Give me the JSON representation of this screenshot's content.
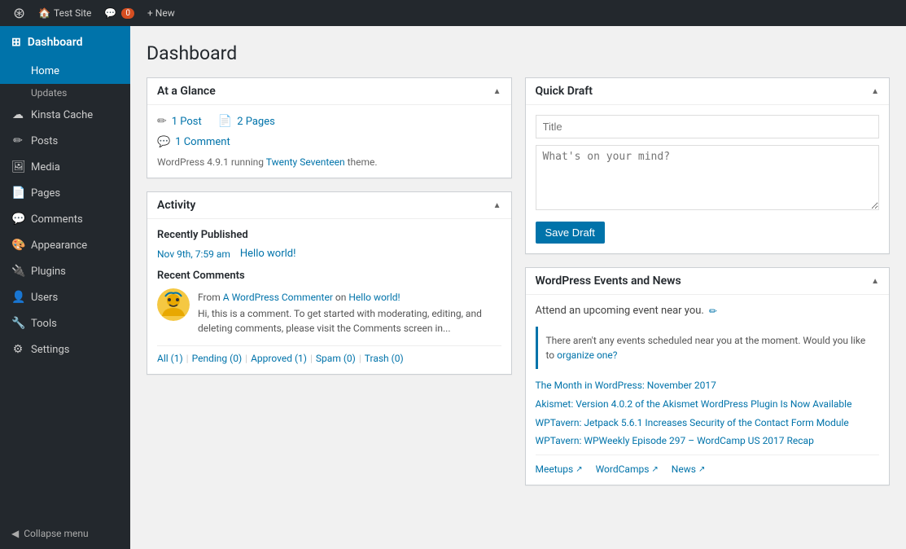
{
  "adminbar": {
    "site_name": "Test Site",
    "comments_count": "0",
    "new_label": "+ New"
  },
  "sidebar": {
    "logo_label": "Dashboard",
    "items": [
      {
        "id": "dashboard",
        "label": "Dashboard",
        "icon": "⊞",
        "active": true
      },
      {
        "id": "home",
        "label": "Home",
        "sub": true
      },
      {
        "id": "updates",
        "label": "Updates",
        "sub": true
      },
      {
        "id": "kinsta-cache",
        "label": "Kinsta Cache",
        "icon": "☁"
      },
      {
        "id": "posts",
        "label": "Posts",
        "icon": "📝"
      },
      {
        "id": "media",
        "label": "Media",
        "icon": "🖼"
      },
      {
        "id": "pages",
        "label": "Pages",
        "icon": "📄"
      },
      {
        "id": "comments",
        "label": "Comments",
        "icon": "💬"
      },
      {
        "id": "appearance",
        "label": "Appearance",
        "icon": "🎨"
      },
      {
        "id": "plugins",
        "label": "Plugins",
        "icon": "🔌"
      },
      {
        "id": "users",
        "label": "Users",
        "icon": "👤"
      },
      {
        "id": "tools",
        "label": "Tools",
        "icon": "🔧"
      },
      {
        "id": "settings",
        "label": "Settings",
        "icon": "⚙"
      }
    ],
    "collapse_label": "Collapse menu"
  },
  "page": {
    "title": "Dashboard"
  },
  "at_a_glance": {
    "widget_title": "At a Glance",
    "post_count": "1 Post",
    "page_count": "2 Pages",
    "comment_count": "1 Comment",
    "wp_info": "WordPress 4.9.1 running ",
    "theme_name": "Twenty Seventeen",
    "theme_suffix": " theme."
  },
  "activity": {
    "widget_title": "Activity",
    "recently_published_title": "Recently Published",
    "published_date": "Nov 9th, 7:59 am",
    "published_post": "Hello world!",
    "recent_comments_title": "Recent Comments",
    "comment_from": "From ",
    "comment_author": "A WordPress Commenter",
    "comment_on": " on ",
    "comment_post": "Hello world!",
    "comment_text": "Hi, this is a comment. To get started with moderating, editing, and deleting comments, please visit the Comments screen in...",
    "filter_all": "All (1)",
    "filter_pending": "Pending (0)",
    "filter_approved": "Approved (1)",
    "filter_spam": "Spam (0)",
    "filter_trash": "Trash (0)"
  },
  "quick_draft": {
    "widget_title": "Quick Draft",
    "title_placeholder": "Title",
    "body_placeholder": "What's on your mind?",
    "save_label": "Save Draft"
  },
  "events_news": {
    "widget_title": "WordPress Events and News",
    "attend_text": "Attend an upcoming event near you.",
    "no_events_text": "There aren't any events scheduled near you at the moment. Would you like to ",
    "organize_link": "organize one?",
    "news_items": [
      "The Month in WordPress: November 2017",
      "Akismet: Version 4.0.2 of the Akismet WordPress Plugin Is Now Available",
      "WPTavern: Jetpack 5.6.1 Increases Security of the Contact Form Module",
      "WPTavern: WPWeekly Episode 297 – WordCamp US 2017 Recap"
    ],
    "meetups_label": "Meetups",
    "wordcamps_label": "WordCamps",
    "news_label": "News"
  }
}
